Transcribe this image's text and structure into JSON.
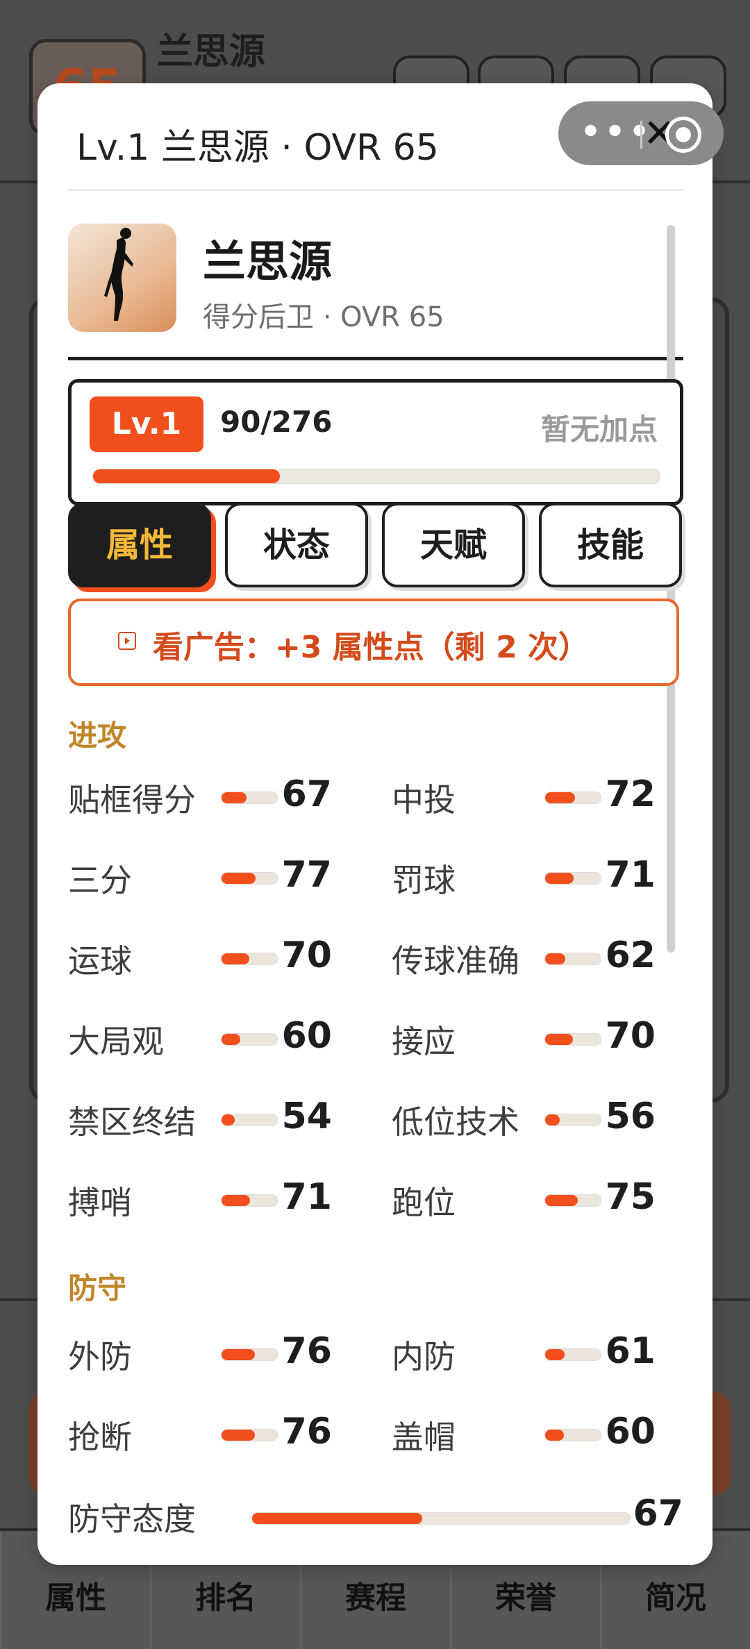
{
  "background": {
    "top_card_value": "65",
    "title": "兰思源",
    "nav": [
      "属性",
      "排名",
      "赛程",
      "荣誉",
      "简况"
    ]
  },
  "modal": {
    "title": "Lv.1 兰思源 · OVR 65",
    "name": "兰思源",
    "subtitle": "得分后卫 · OVR 65",
    "capsule": {
      "more": "•••",
      "close": "✕"
    },
    "level": {
      "badge": "Lv.1",
      "xp": "90/276",
      "status": "暂无加点",
      "progress": 0.33
    },
    "tabs": [
      {
        "label": "属性",
        "active": true
      },
      {
        "label": "状态",
        "active": false
      },
      {
        "label": "天赋",
        "active": false
      },
      {
        "label": "技能",
        "active": false
      }
    ],
    "ad_button": "看广告：+3 属性点（剩 2 次）",
    "sections": {
      "attack": {
        "title": "进攻",
        "stats": [
          {
            "label": "贴框得分",
            "value": 67
          },
          {
            "label": "中投",
            "value": 72
          },
          {
            "label": "三分",
            "value": 77
          },
          {
            "label": "罚球",
            "value": 71
          },
          {
            "label": "运球",
            "value": 70
          },
          {
            "label": "传球准确",
            "value": 62
          },
          {
            "label": "大局观",
            "value": 60
          },
          {
            "label": "接应",
            "value": 70
          },
          {
            "label": "禁区终结",
            "value": 54
          },
          {
            "label": "低位技术",
            "value": 56
          },
          {
            "label": "搏哨",
            "value": 71
          },
          {
            "label": "跑位",
            "value": 75
          }
        ]
      },
      "defense": {
        "title": "防守",
        "stats": [
          {
            "label": "外防",
            "value": 76
          },
          {
            "label": "内防",
            "value": 61
          },
          {
            "label": "抢断",
            "value": 76
          },
          {
            "label": "盖帽",
            "value": 60
          }
        ],
        "attitude": {
          "label": "防守态度",
          "value": 67
        }
      }
    }
  },
  "colors": {
    "accent": "#f24f1d",
    "section": "#c0862a",
    "tab_active_text": "#f5b93a"
  }
}
